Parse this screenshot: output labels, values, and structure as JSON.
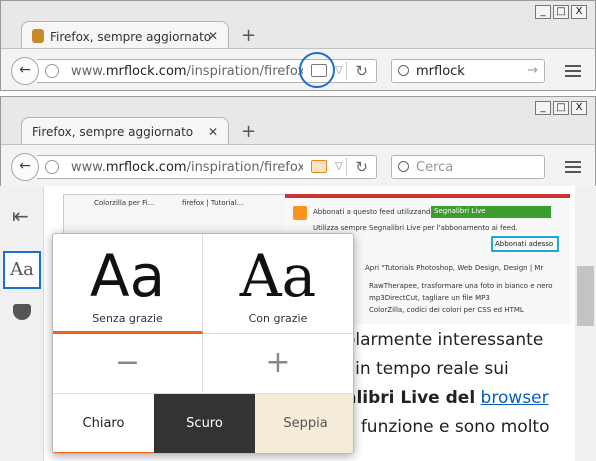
{
  "window1": {
    "tab_title": "Firefox, sempre aggiornato",
    "url_domain": "mrflock.com",
    "url_prefix": "www.",
    "url_path": "/inspiration/firefox-s",
    "search_value": "mrflock"
  },
  "window2": {
    "tab_title": "Firefox, sempre aggiornato",
    "url_domain": "mrflock.com",
    "url_prefix": "www.",
    "url_path": "/inspiration/firefox-s",
    "search_placeholder": "Cerca"
  },
  "window_controls": [
    "_",
    "□",
    "X"
  ],
  "embedded": {
    "abbonati_text": "Abbonati a questo feed utilizzando",
    "select_value": "Segnalibri Live",
    "checkbox_text": "Utilizza sempre Segnalibri Live per l'abbonamento ai feed.",
    "button": "Abbonati adesso",
    "feed_title": "Apri \"Tutorials Photoshop, Web Design, Design | Mr",
    "items": [
      "RawTherapee, trasformare una foto in bianco e nero",
      "mp3DirectCut, tagliare un file MP3",
      "ColorZilla, codici dei colori per CSS ed HTML"
    ],
    "mini_tabs": [
      "Colorzilla per Fi...",
      "firefox | Tutorial..."
    ]
  },
  "article": {
    "line1": "olarmente interessante",
    "line2": "i in tempo reale sui",
    "line3_bold": "alibri Live del",
    "line3_link": "browser",
    "line4": "a funzione e sono molto"
  },
  "reader_panel": {
    "font_sans_sample": "Aa",
    "font_sans_label": "Senza grazie",
    "font_serif_sample": "Aa",
    "font_serif_label": "Con grazie",
    "decrease": "−",
    "increase": "+",
    "theme_light": "Chiaro",
    "theme_dark": "Scuro",
    "theme_sepia": "Seppia"
  },
  "sidebar": {
    "type_button": "Aa"
  },
  "colors": {
    "accent": "#f06418",
    "highlight": "#1a6fd0"
  }
}
